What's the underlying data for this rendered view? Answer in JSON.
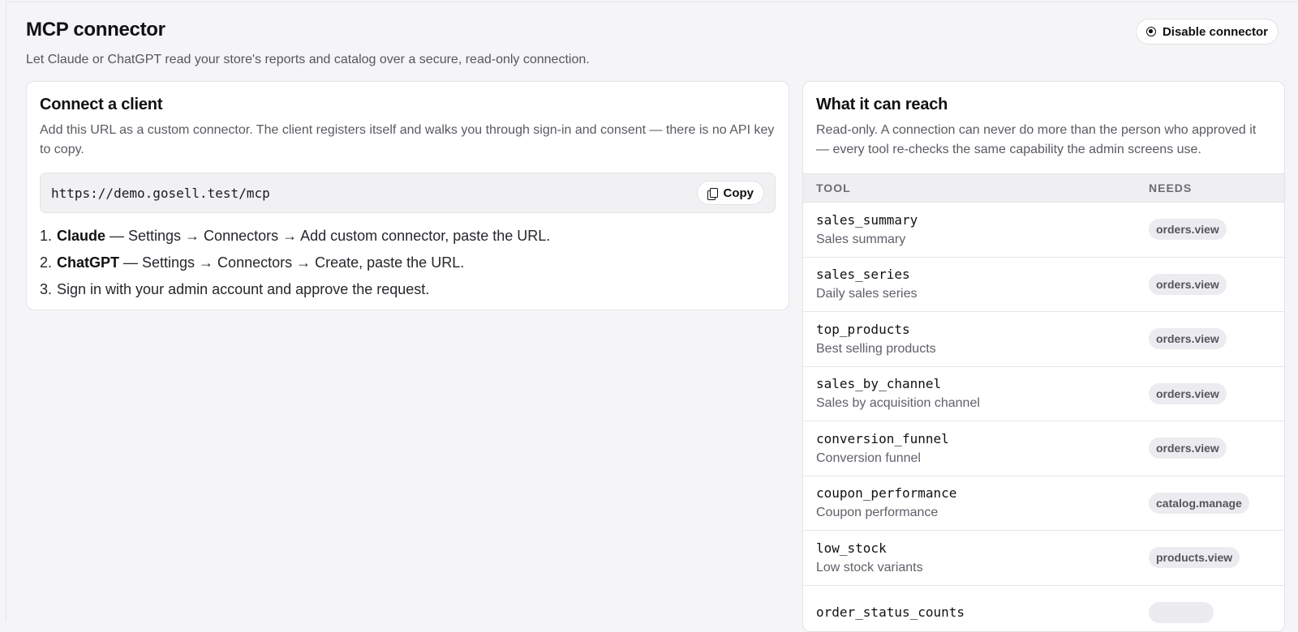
{
  "header": {
    "title": "MCP connector",
    "subtitle": "Let Claude or ChatGPT read your store's reports and catalog over a secure, read-only connection.",
    "disable_label": "Disable connector"
  },
  "connect": {
    "title": "Connect a client",
    "description": "Add this URL as a custom connector. The client registers itself and walks you through sign-in and consent — there is no API key to copy.",
    "url": "https://demo.gosell.test/mcp",
    "copy_label": "Copy",
    "steps": [
      {
        "num": "1.",
        "bold": "Claude",
        "rest": " — Settings → Connectors → Add custom connector, paste the URL."
      },
      {
        "num": "2.",
        "bold": "ChatGPT",
        "rest": " — Settings → Connectors → Create, paste the URL."
      },
      {
        "num": "3.",
        "bold": "",
        "rest": "Sign in with your admin account and approve the request."
      }
    ]
  },
  "reach": {
    "title": "What it can reach",
    "description": "Read-only. A connection can never do more than the person who approved it — every tool re-checks the same capability the admin screens use.",
    "columns": {
      "tool": "TOOL",
      "needs": "NEEDS"
    },
    "rows": [
      {
        "tool": "sales_summary",
        "desc": "Sales summary",
        "needs": "orders.view"
      },
      {
        "tool": "sales_series",
        "desc": "Daily sales series",
        "needs": "orders.view"
      },
      {
        "tool": "top_products",
        "desc": "Best selling products",
        "needs": "orders.view"
      },
      {
        "tool": "sales_by_channel",
        "desc": "Sales by acquisition channel",
        "needs": "orders.view"
      },
      {
        "tool": "conversion_funnel",
        "desc": "Conversion funnel",
        "needs": "orders.view"
      },
      {
        "tool": "coupon_performance",
        "desc": "Coupon performance",
        "needs": "catalog.manage"
      },
      {
        "tool": "low_stock",
        "desc": "Low stock variants",
        "needs": "products.view"
      },
      {
        "tool": "order_status_counts",
        "desc": "",
        "needs": ""
      }
    ]
  }
}
